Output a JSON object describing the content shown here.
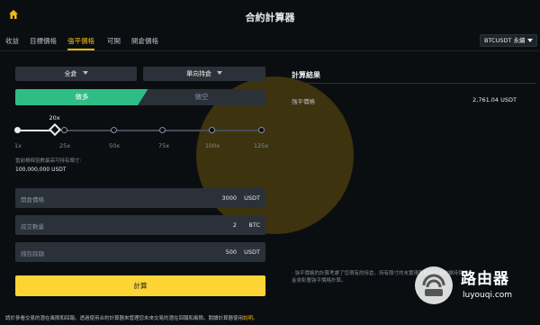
{
  "header": {
    "title": "合約計算器"
  },
  "tabs": [
    "收益",
    "目標價格",
    "強平價格",
    "可開",
    "開倉價格"
  ],
  "symbol": {
    "label": "BTCUSDT 永續"
  },
  "controls": {
    "margin_mode": "全倉",
    "position_mode": "單向持倉"
  },
  "side": {
    "long": "做多",
    "short": "做空"
  },
  "leverage": {
    "current_label": "20x",
    "current_value": 20,
    "ticks": [
      "1x",
      "25x",
      "50x",
      "75x",
      "100x",
      "125x"
    ],
    "note": "當前槓桿倍數最高可持有頭寸:",
    "max_position": "100,000,000 USDT"
  },
  "fields": [
    {
      "label": "開倉價格",
      "value": "3000",
      "unit": "USDT"
    },
    {
      "label": "成交數量",
      "value": "2",
      "unit": "BTC"
    },
    {
      "label": "錢包餘額",
      "value": "500",
      "unit": "USDT"
    }
  ],
  "calculate_label": "計算",
  "results": {
    "title": "計算結果",
    "liq_label": "強平價格",
    "liq_value": "2,761.04 USDT",
    "disclaimer": "· 強平價格的計算考慮了您現有的持倉。持有頭寸的未實現盈虧和佔用的維持保證金會影響強平價格計算。"
  },
  "footer": {
    "text": "請於參看交易的潛在風險和回報。透過使用合約計算器來管理您未來交易的潛在回報和風險。閱讀計算器使用",
    "link": "說明",
    "end": "。"
  },
  "brand": {
    "name": "路由器",
    "url": "luyouqi.com"
  },
  "colors": {
    "accent": "#f0b90b",
    "long": "#2ebd85",
    "button": "#fcd535",
    "background": "#0b0e11"
  }
}
